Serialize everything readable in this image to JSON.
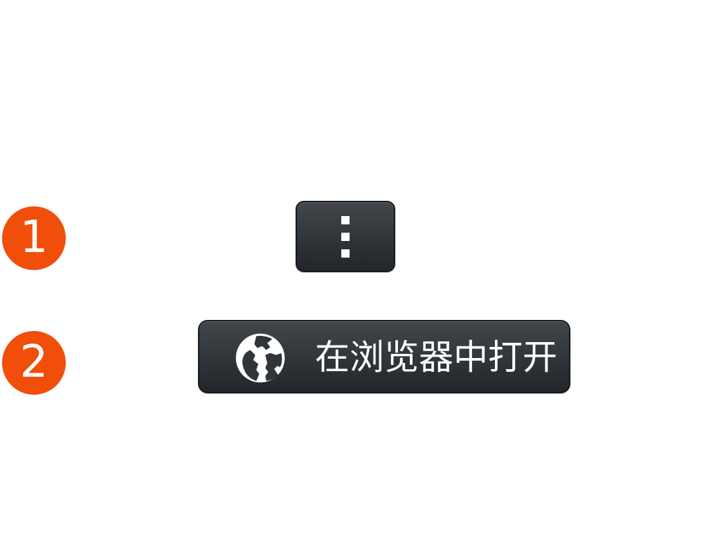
{
  "steps": [
    {
      "number": "1"
    },
    {
      "number": "2"
    }
  ],
  "menu_button": {
    "icon": "vertical-ellipsis-icon"
  },
  "open_in_browser_button": {
    "icon": "globe-icon",
    "label": "在浏览器中打开"
  },
  "colors": {
    "badge": "#f04e0a",
    "button_top": "#42474c",
    "button_bottom": "#22262a",
    "button_text": "#ffffff"
  }
}
